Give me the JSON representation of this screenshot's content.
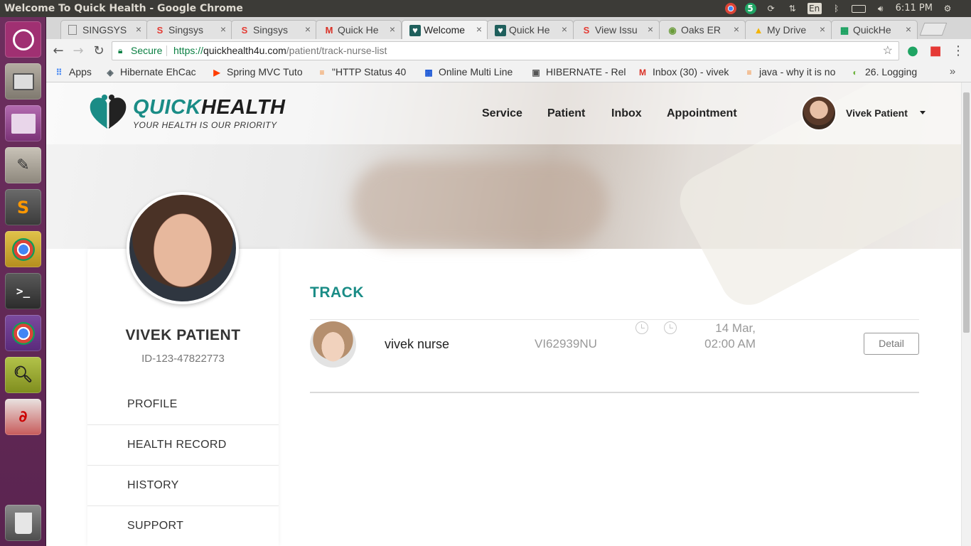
{
  "window": {
    "title": "Welcome To Quick Health - Google Chrome"
  },
  "tray": {
    "chrome_badge": "5",
    "keyboard": "En",
    "time": "6:11 PM"
  },
  "tabs": [
    {
      "label": "SINGSYS",
      "icon": "page-icon"
    },
    {
      "label": "Singsys",
      "icon": "s-logo-icon"
    },
    {
      "label": "Singsys",
      "icon": "s-logo-icon"
    },
    {
      "label": "Quick He",
      "icon": "gmail-icon"
    },
    {
      "label": "Welcome",
      "icon": "quickhealth-icon"
    },
    {
      "label": "Quick He",
      "icon": "quickhealth-icon"
    },
    {
      "label": "View Issu",
      "icon": "s-logo-icon"
    },
    {
      "label": "Oaks ER",
      "icon": "oaks-icon"
    },
    {
      "label": "My Drive",
      "icon": "drive-icon"
    },
    {
      "label": "QuickHe",
      "icon": "sheets-icon"
    }
  ],
  "address": {
    "secure_label": "Secure",
    "protocol": "https://",
    "host": "quickhealth4u.com",
    "path": "/patient/track-nurse-list"
  },
  "bookmarks": [
    {
      "label": "Apps",
      "icon": "apps-grid-icon"
    },
    {
      "label": "Hibernate EhCac",
      "icon": "hibernate-icon"
    },
    {
      "label": "Spring MVC Tuto",
      "icon": "youtube-icon"
    },
    {
      "label": "\"HTTP Status 40",
      "icon": "stackoverflow-icon"
    },
    {
      "label": "Online Multi Line",
      "icon": "checker-icon"
    },
    {
      "label": "HIBERNATE - Rel",
      "icon": "jboss-icon"
    },
    {
      "label": "Inbox (30) - vivek",
      "icon": "gmail-icon"
    },
    {
      "label": "java - why it is no",
      "icon": "stackoverflow-icon"
    },
    {
      "label": "26. Logging",
      "icon": "spring-icon"
    }
  ],
  "site": {
    "brand_left": "QUICK",
    "brand_right": "HEALTH",
    "tagline": "YOUR HEALTH IS OUR PRIORITY",
    "menu": [
      "Service",
      "Patient",
      "Inbox",
      "Appointment"
    ],
    "user_name": "Vivek Patient",
    "accent": "#1a8c86"
  },
  "profile": {
    "name": "VIVEK PATIENT",
    "id": "ID-123-47822773",
    "nav": [
      "PROFILE",
      "HEALTH RECORD",
      "HISTORY",
      "SUPPORT"
    ]
  },
  "track": {
    "title": "TRACK",
    "rows": [
      {
        "name": "vivek nurse",
        "code": "VI62939NU",
        "date_line1": "14 Mar,",
        "date_line2": "02:00 AM",
        "button": "Detail"
      }
    ]
  }
}
